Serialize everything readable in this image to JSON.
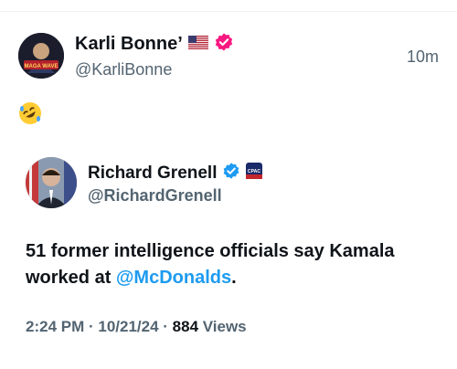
{
  "tweet": {
    "author": {
      "display_name": "Karli Bonne’",
      "handle": "@KarliBonne",
      "avatar_caption": "MAGA WAVE",
      "flag": "us-flag-icon",
      "verified_color": "#f91880"
    },
    "time": "10m",
    "text_emoji": "rolling-on-the-floor-laughing-icon"
  },
  "quoted_tweet": {
    "author": {
      "display_name": "Richard Grenell",
      "handle": "@RichardGrenell",
      "verified_color": "#1d9bf0",
      "affiliate_badge": "cpac-badge-icon",
      "affiliate_badge_text": "CPAC"
    },
    "text_before": "51 former intelligence officials say Kamala worked at ",
    "mention": "@McDonalds",
    "text_after": ".",
    "meta": {
      "time": "2:24 PM",
      "sep1": " · ",
      "date": "10/21/24",
      "sep2": " · ",
      "views": "884",
      "views_label": " Views"
    }
  },
  "colors": {
    "text_primary": "#0f1419",
    "text_secondary": "#536471",
    "link": "#1d9bf0"
  }
}
